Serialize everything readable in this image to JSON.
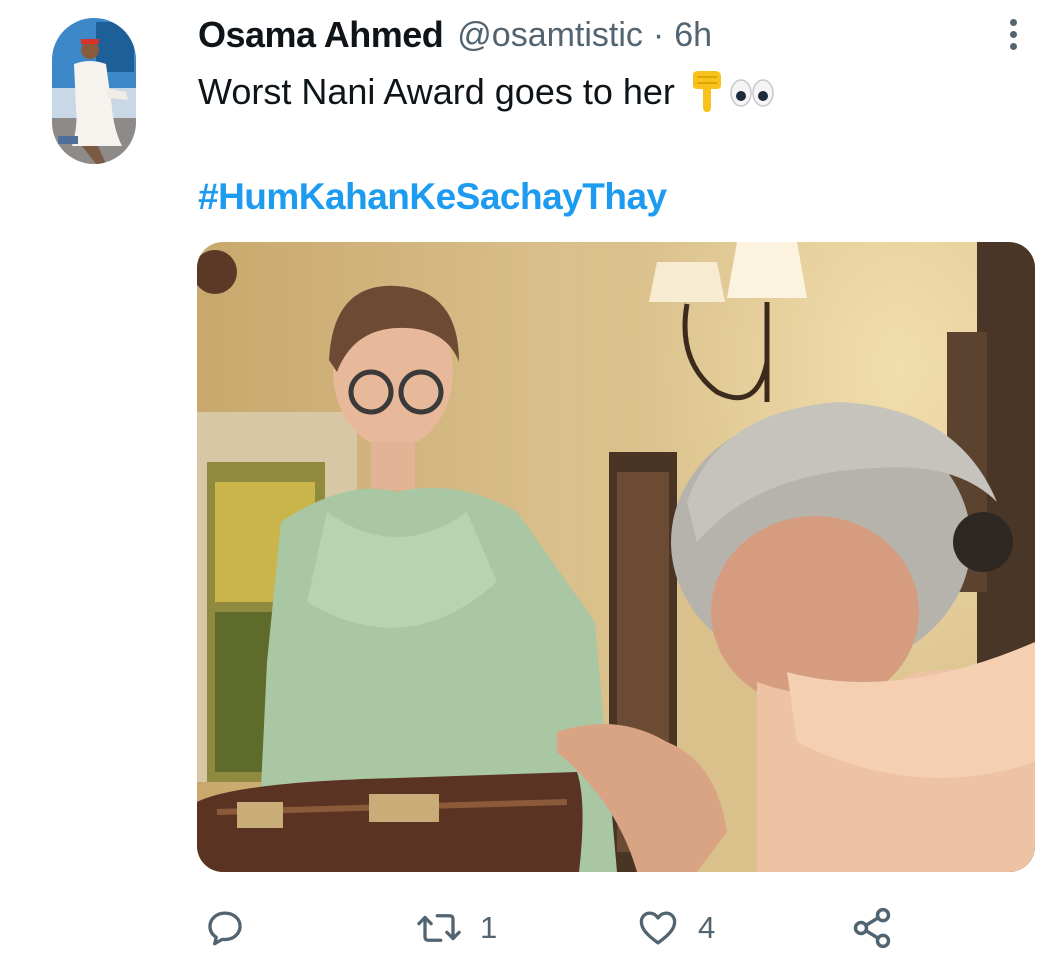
{
  "tweet": {
    "author_name": "Osama Ahmed",
    "handle": "@osamtistic",
    "separator": "·",
    "time": "6h",
    "text": "Worst Nani Award goes to her",
    "emoji_glyphs": "👇👀",
    "hashtag": "#HumKahanKeSachayThay"
  },
  "actions": {
    "reply_count": "",
    "retweet_count": "1",
    "like_count": "4"
  },
  "colors": {
    "accent": "#1d9bf0",
    "secondary_text": "#536471",
    "primary_text": "#0f1419"
  },
  "icons": {
    "more": "more-dots-vertical-icon",
    "reply": "reply-bubble-icon",
    "retweet": "retweet-arrows-icon",
    "like": "heart-icon",
    "share": "share-nodes-icon",
    "emoji_1": "backhand-index-pointing-down-emoji",
    "emoji_2": "eyes-emoji"
  }
}
